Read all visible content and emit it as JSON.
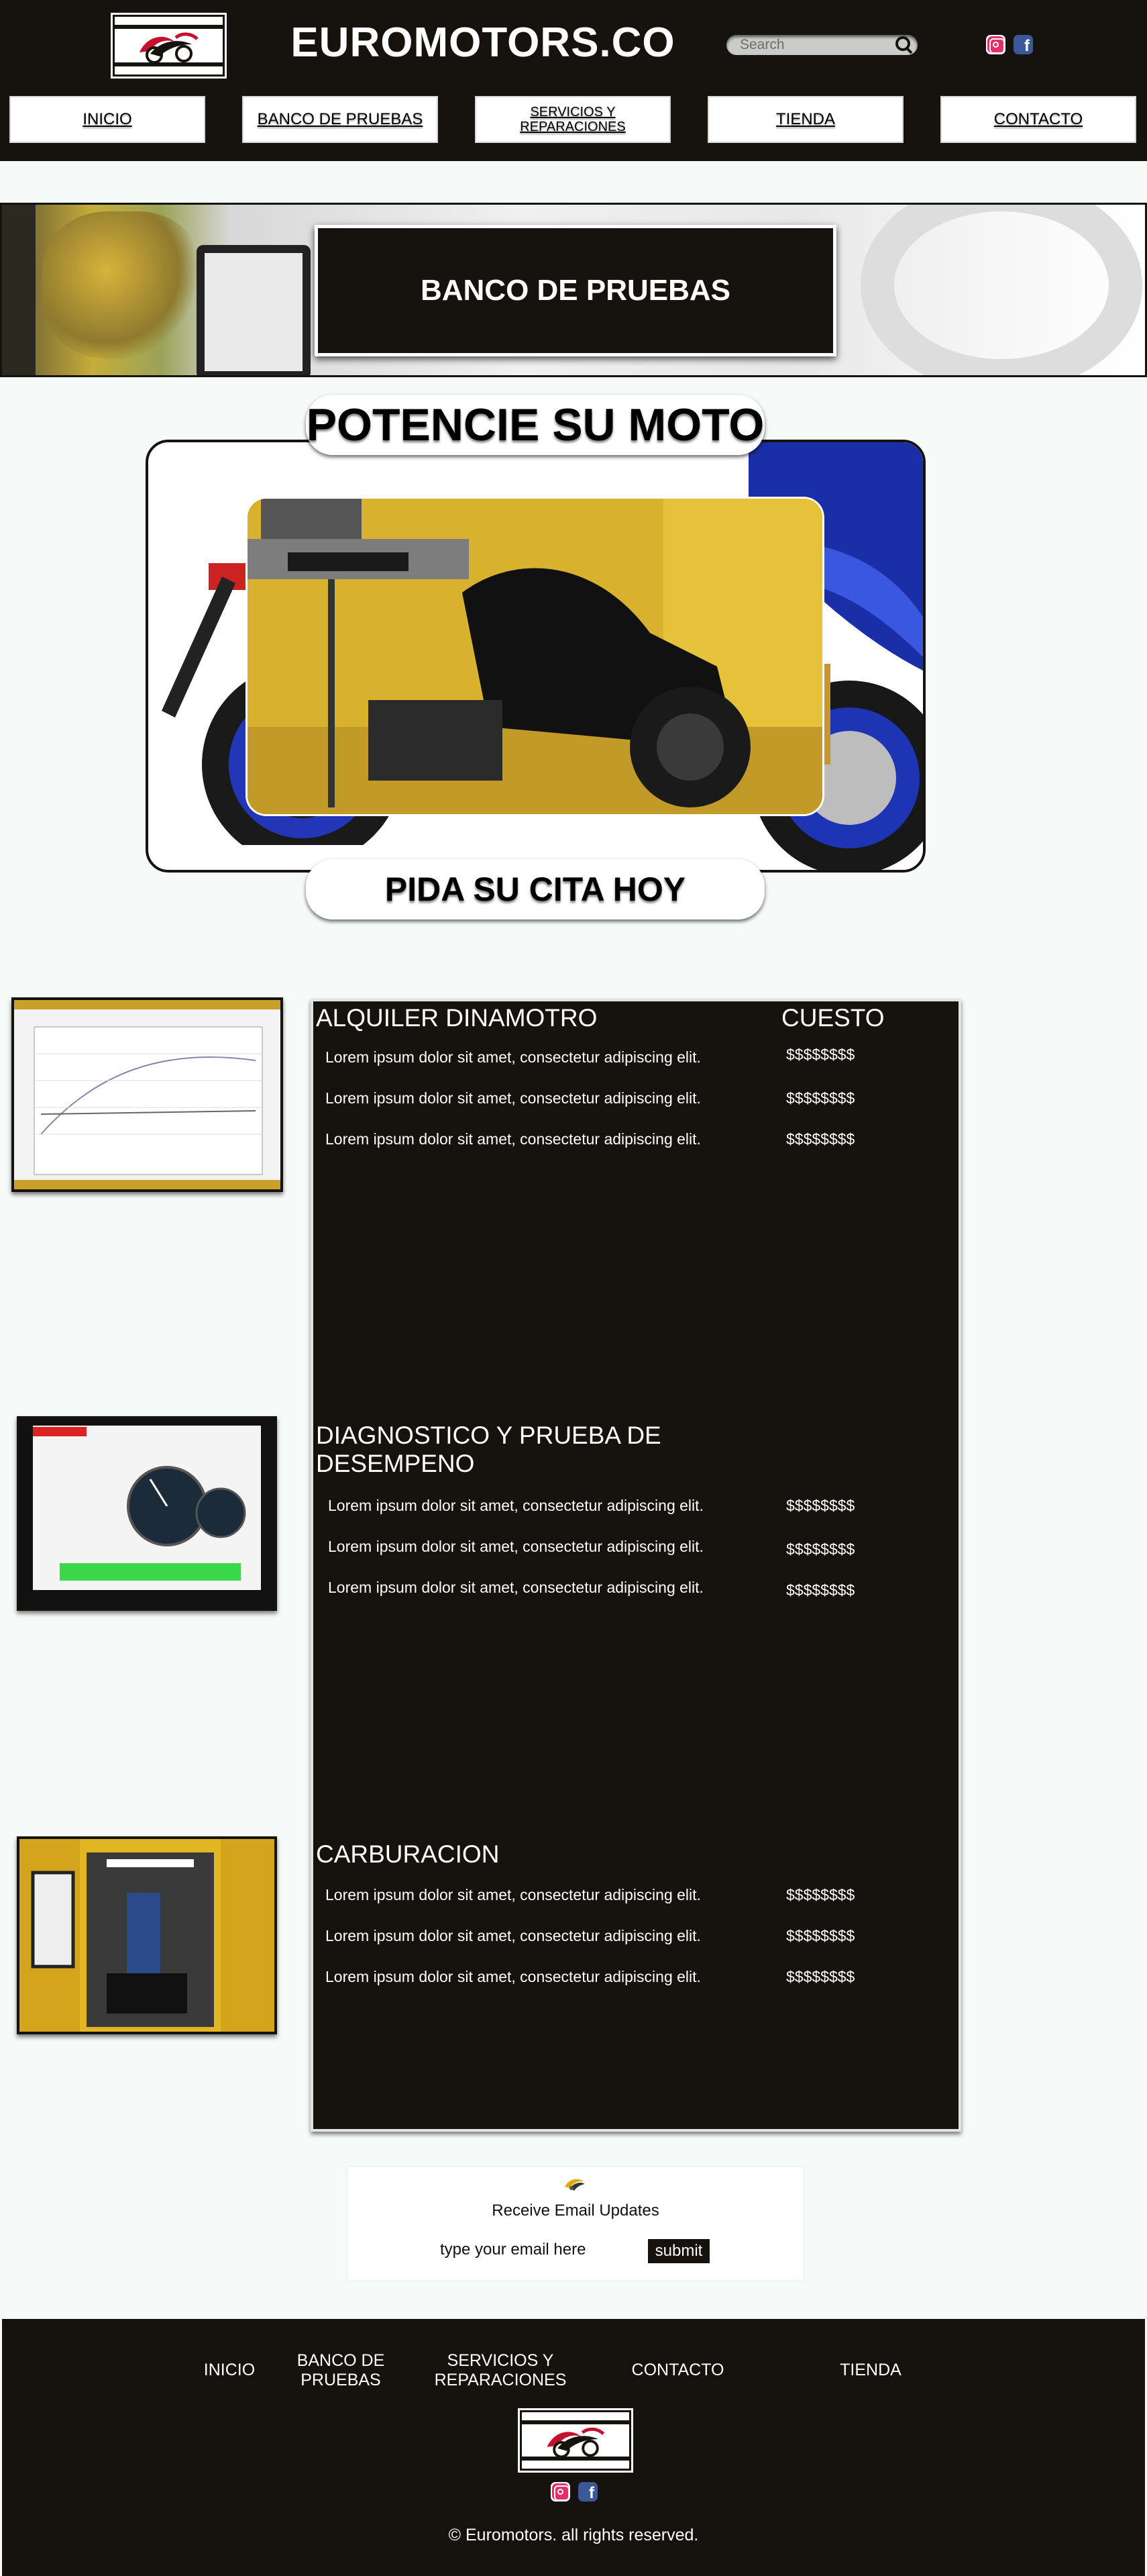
{
  "header": {
    "site_title": "EUROMOTORS.CO",
    "search_placeholder": "Search",
    "social": [
      "instagram-icon",
      "facebook-icon"
    ]
  },
  "nav": [
    {
      "label": "INICIO"
    },
    {
      "label": "BANCO DE PRUEBAS"
    },
    {
      "label": "SERVICIOS Y REPARACIONES"
    },
    {
      "label": "TIENDA"
    },
    {
      "label": "CONTACTO"
    }
  ],
  "banner": {
    "title": "BANCO DE PRUEBAS"
  },
  "hero": {
    "headline": "POTENCIE SU MOTO",
    "cta": "PIDA SU CITA HOY"
  },
  "services": {
    "cost_header": "CUESTO",
    "sections": [
      {
        "title": "ALQUILER DINAMOTRO",
        "rows": [
          {
            "text": "Lorem ipsum dolor sit amet, consectetur adipiscing elit.",
            "price": "$$$$$$$$"
          },
          {
            "text": "Lorem ipsum dolor sit amet, consectetur adipiscing elit.",
            "price": "$$$$$$$$"
          },
          {
            "text": "Lorem ipsum dolor sit amet, consectetur adipiscing elit.",
            "price": "$$$$$$$$"
          }
        ]
      },
      {
        "title": "DIAGNOSTICO Y PRUEBA DE DESEMPENO",
        "rows": [
          {
            "text": "Lorem ipsum dolor sit amet, consectetur adipiscing elit.",
            "price": "$$$$$$$$"
          },
          {
            "text": "Lorem ipsum dolor sit amet, consectetur adipiscing elit.",
            "price": "$$$$$$$$"
          },
          {
            "text": "Lorem ipsum dolor sit amet, consectetur adipiscing elit.",
            "price": "$$$$$$$$"
          }
        ]
      },
      {
        "title": "CARBURACION",
        "rows": [
          {
            "text": "Lorem ipsum dolor sit amet, consectetur adipiscing elit.",
            "price": "$$$$$$$$"
          },
          {
            "text": "Lorem ipsum dolor sit amet, consectetur adipiscing elit.",
            "price": "$$$$$$$$"
          },
          {
            "text": "Lorem ipsum dolor sit amet, consectetur adipiscing elit.",
            "price": "$$$$$$$$"
          }
        ]
      }
    ]
  },
  "email": {
    "title": "Receive Email Updates",
    "placeholder": "type your email here",
    "submit": "submit"
  },
  "footer": {
    "links": [
      {
        "label": "INICIO"
      },
      {
        "label": "BANCO DE PRUEBAS"
      },
      {
        "label": "SERVICIOS Y REPARACIONES"
      },
      {
        "label": "CONTACTO"
      },
      {
        "label": "TIENDA"
      }
    ],
    "copyright": "© Euromotors. all rights reserved."
  },
  "colors": {
    "dark": "#16130e",
    "background": "#f6fbfa",
    "accent_red": "#c8102e"
  }
}
